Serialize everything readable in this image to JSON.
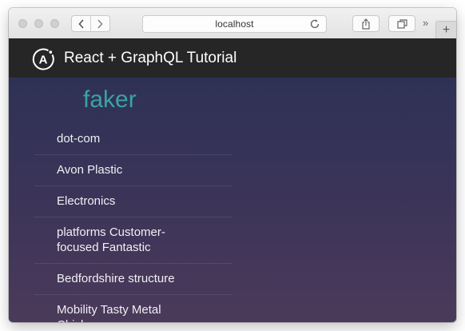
{
  "browser": {
    "address": "localhost",
    "newtab_label": "+",
    "overflow_label": "»"
  },
  "header": {
    "logo_letter": "A",
    "title": "React + GraphQL Tutorial"
  },
  "page": {
    "heading": "faker",
    "items": [
      "dot-com",
      "Avon Plastic",
      "Electronics",
      "platforms Customer-focused Fantastic",
      "Bedfordshire structure",
      "Mobility Tasty Metal Chicken"
    ]
  },
  "colors": {
    "heading": "#3ba39f",
    "header_bg": "#262626",
    "content_bg_top": "#2e3156",
    "content_bg_bottom": "#4b3a5a"
  }
}
